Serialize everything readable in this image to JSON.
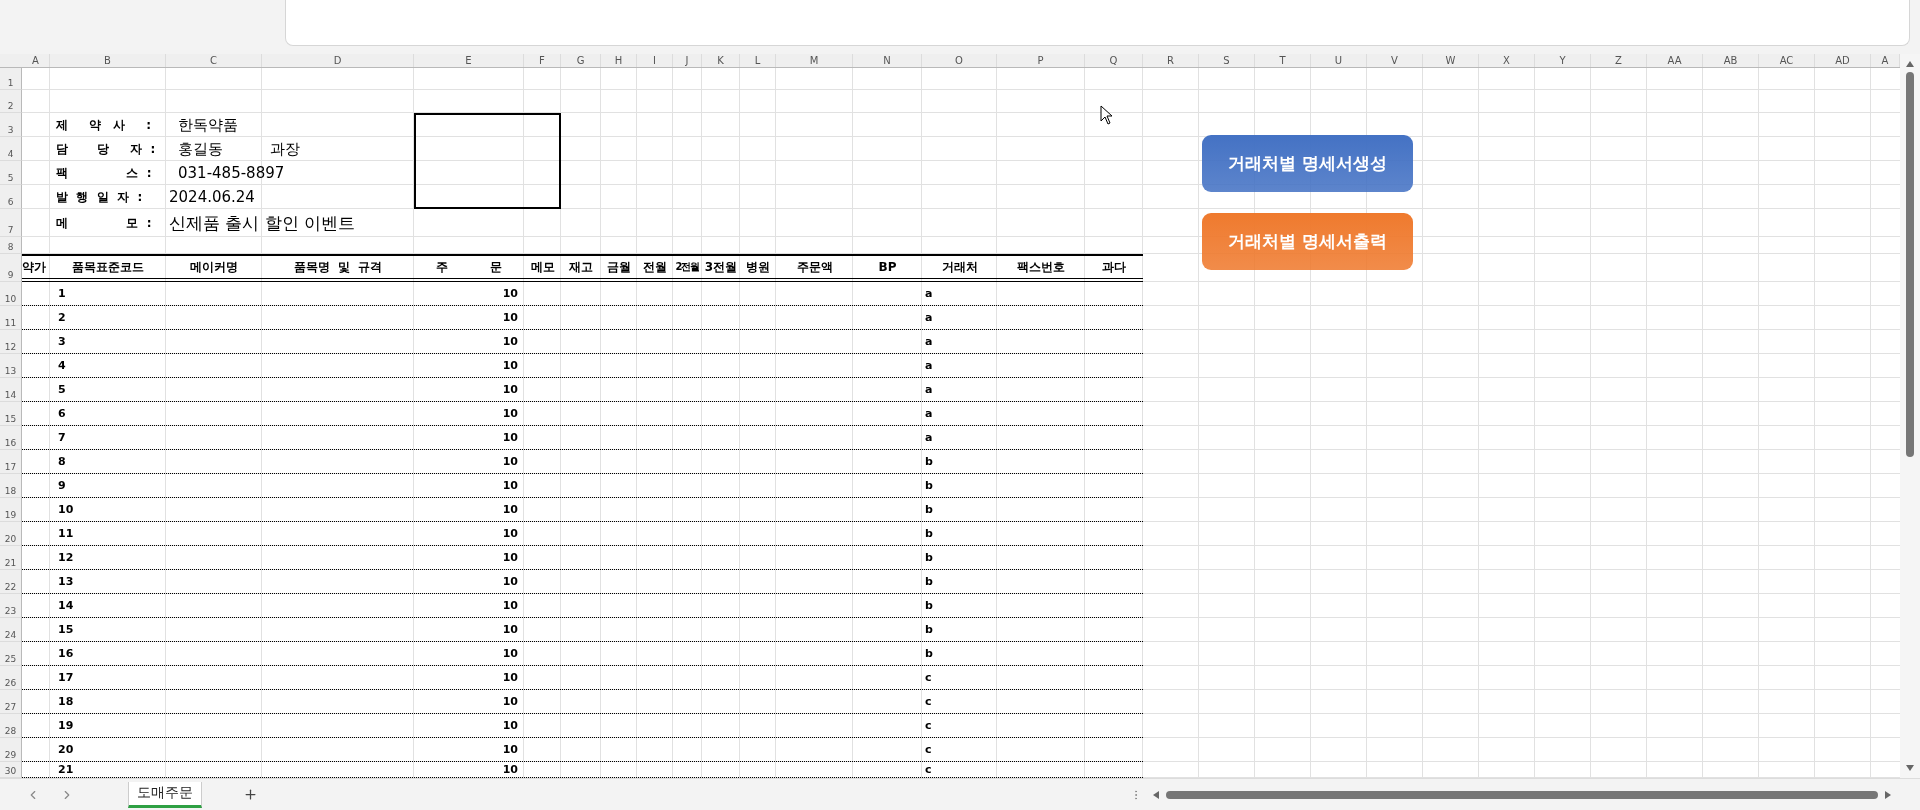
{
  "column_letters": [
    "A",
    "B",
    "C",
    "D",
    "E",
    "F",
    "G",
    "H",
    "I",
    "J",
    "K",
    "L",
    "M",
    "N",
    "O",
    "P",
    "Q",
    "R",
    "S",
    "T",
    "U",
    "V",
    "W",
    "X",
    "Y",
    "Z",
    "AA",
    "AB",
    "AC",
    "AD",
    "A"
  ],
  "row_numbers": [
    "1",
    "2",
    "3",
    "4",
    "5",
    "6",
    "7",
    "8",
    "9",
    "10",
    "11",
    "12",
    "13",
    "14",
    "15",
    "16",
    "17",
    "18",
    "19",
    "20",
    "21",
    "22",
    "23",
    "24",
    "25",
    "26",
    "27",
    "28",
    "29",
    "30"
  ],
  "info": [
    {
      "label": "제     약   사     :",
      "value": "한독약품"
    },
    {
      "label": "담       당     자  :",
      "value": "홍길동",
      "extra": "과장"
    },
    {
      "label": "팩              스  :",
      "value": "031-485-8897"
    },
    {
      "label": "발  행  일  자  :",
      "value": "2024.06.24"
    },
    {
      "label": "메              모  :",
      "value": "신제품 출시 할인 이벤트"
    }
  ],
  "table_headers": [
    "약가",
    "품목표준코드",
    "메이커명",
    "품목명  및  규격",
    "주          문",
    "메모",
    "재고",
    "금월",
    "전월",
    "2전월",
    "3전월",
    "병원",
    "주문액",
    "BP",
    "거래처",
    "팩스번호",
    "과다"
  ],
  "rows": [
    {
      "code": "1",
      "order": "10",
      "client": "a"
    },
    {
      "code": "2",
      "order": "10",
      "client": "a"
    },
    {
      "code": "3",
      "order": "10",
      "client": "a"
    },
    {
      "code": "4",
      "order": "10",
      "client": "a"
    },
    {
      "code": "5",
      "order": "10",
      "client": "a"
    },
    {
      "code": "6",
      "order": "10",
      "client": "a"
    },
    {
      "code": "7",
      "order": "10",
      "client": "a"
    },
    {
      "code": "8",
      "order": "10",
      "client": "b"
    },
    {
      "code": "9",
      "order": "10",
      "client": "b"
    },
    {
      "code": "10",
      "order": "10",
      "client": "b"
    },
    {
      "code": "11",
      "order": "10",
      "client": "b"
    },
    {
      "code": "12",
      "order": "10",
      "client": "b"
    },
    {
      "code": "13",
      "order": "10",
      "client": "b"
    },
    {
      "code": "14",
      "order": "10",
      "client": "b"
    },
    {
      "code": "15",
      "order": "10",
      "client": "b"
    },
    {
      "code": "16",
      "order": "10",
      "client": "b"
    },
    {
      "code": "17",
      "order": "10",
      "client": "c"
    },
    {
      "code": "18",
      "order": "10",
      "client": "c"
    },
    {
      "code": "19",
      "order": "10",
      "client": "c"
    },
    {
      "code": "20",
      "order": "10",
      "client": "c"
    },
    {
      "code": "21",
      "order": "10",
      "client": "c"
    }
  ],
  "buttons": [
    {
      "label": "거래처별 명세서생성",
      "color": "#4472c4"
    },
    {
      "label": "거래처별 명세서출력",
      "color": "#ef7a2e"
    }
  ],
  "sheet_tabs": [
    {
      "label": "도매주문",
      "selected": true
    }
  ]
}
